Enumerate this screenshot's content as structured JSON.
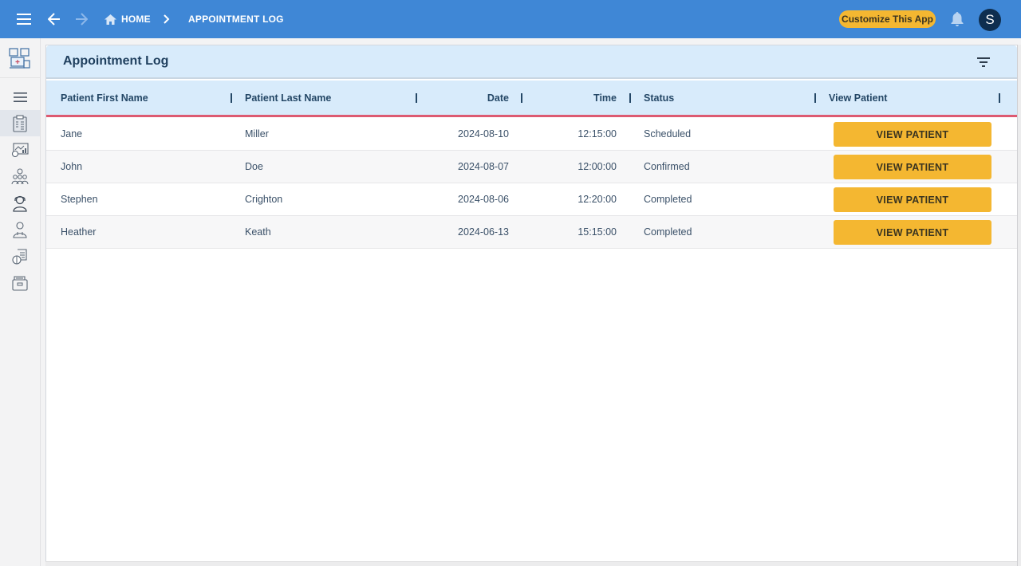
{
  "topbar": {
    "menu_icon": "hamburger-menu-icon",
    "back_icon": "arrow-left-icon",
    "forward_icon": "arrow-right-icon",
    "breadcrumb": [
      {
        "label": "HOME",
        "icon": "home-icon"
      },
      {
        "label": "APPOINTMENT LOG"
      }
    ],
    "customize_label": "Customize This App",
    "notifications_icon": "bell-icon",
    "avatar_initial": "S"
  },
  "sidebar": {
    "logo": "clinic-app-logo",
    "items": [
      {
        "name": "menu",
        "icon": "hamburger-menu-icon"
      },
      {
        "name": "appointment-log",
        "icon": "clipboard-icon",
        "active": true
      },
      {
        "name": "reports",
        "icon": "chart-board-icon"
      },
      {
        "name": "patients",
        "icon": "group-icon"
      },
      {
        "name": "receptionist",
        "icon": "headset-person-icon"
      },
      {
        "name": "doctors",
        "icon": "doctor-icon"
      },
      {
        "name": "prescriptions",
        "icon": "pills-document-icon"
      },
      {
        "name": "records",
        "icon": "file-drawer-icon"
      }
    ]
  },
  "panel": {
    "title": "Appointment Log",
    "filter_icon": "filter-icon"
  },
  "table": {
    "columns": [
      "Patient First Name",
      "Patient Last Name",
      "Date",
      "Time",
      "Status",
      "View Patient"
    ],
    "rows": [
      {
        "first": "Jane",
        "last": "Miller",
        "date": "2024-08-10",
        "time": "12:15:00",
        "status": "Scheduled",
        "action": "VIEW PATIENT"
      },
      {
        "first": "John",
        "last": "Doe",
        "date": "2024-08-07",
        "time": "12:00:00",
        "status": "Confirmed",
        "action": "VIEW PATIENT"
      },
      {
        "first": "Stephen",
        "last": "Crighton",
        "date": "2024-08-06",
        "time": "12:20:00",
        "status": "Completed",
        "action": "VIEW PATIENT"
      },
      {
        "first": "Heather",
        "last": "Keath",
        "date": "2024-06-13",
        "time": "15:15:00",
        "status": "Completed",
        "action": "VIEW PATIENT"
      }
    ]
  },
  "colors": {
    "topbar": "#3f87d6",
    "accent_button": "#f4b731",
    "header_bg": "#d8ebfb",
    "header_underline": "#dd5a71",
    "avatar_bg": "#0e2e4f"
  }
}
